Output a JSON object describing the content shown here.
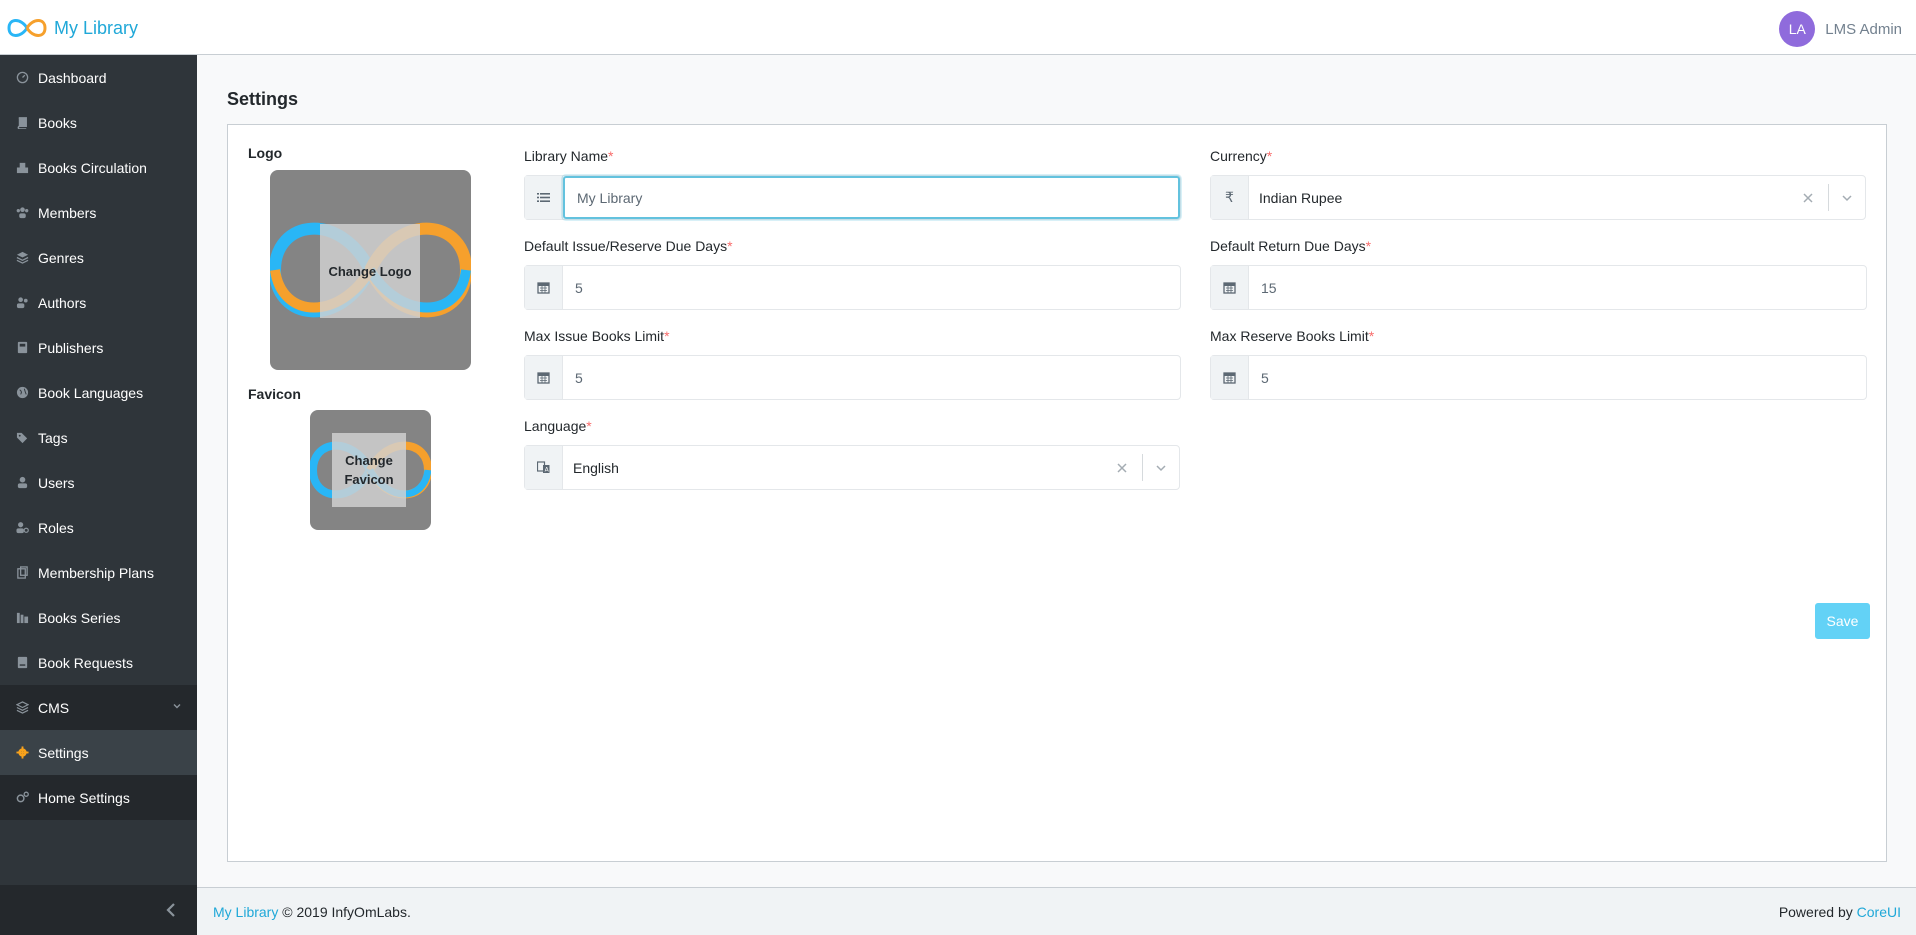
{
  "header": {
    "brand": "My Library",
    "user_initials": "LA",
    "user_name": "LMS Admin"
  },
  "sidebar": {
    "items": [
      {
        "label": "Dashboard",
        "icon": "speedometer-icon"
      },
      {
        "label": "Books",
        "icon": "book-icon"
      },
      {
        "label": "Books Circulation",
        "icon": "circulation-icon"
      },
      {
        "label": "Members",
        "icon": "members-icon"
      },
      {
        "label": "Genres",
        "icon": "layers-icon"
      },
      {
        "label": "Authors",
        "icon": "authors-icon"
      },
      {
        "label": "Publishers",
        "icon": "publisher-icon"
      },
      {
        "label": "Book Languages",
        "icon": "globe-icon"
      },
      {
        "label": "Tags",
        "icon": "tags-icon"
      },
      {
        "label": "Users",
        "icon": "user-icon"
      },
      {
        "label": "Roles",
        "icon": "user-cog-icon"
      },
      {
        "label": "Membership Plans",
        "icon": "plans-icon"
      },
      {
        "label": "Books Series",
        "icon": "series-icon"
      },
      {
        "label": "Book Requests",
        "icon": "request-icon"
      },
      {
        "label": "CMS",
        "icon": "layers-icon"
      },
      {
        "label": "Settings",
        "icon": "gear-icon"
      },
      {
        "label": "Home Settings",
        "icon": "cogs-icon"
      }
    ],
    "active_item": "Settings",
    "active_color": "#f8a21c"
  },
  "page": {
    "title": "Settings"
  },
  "settings": {
    "logo_label": "Logo",
    "logo_button": "Change Logo",
    "favicon_label": "Favicon",
    "favicon_button": "Change Favicon",
    "library_name": {
      "label": "Library Name",
      "value": "My Library",
      "icon": "list-icon"
    },
    "currency": {
      "label": "Currency",
      "value": "Indian Rupee",
      "icon": "rupee-icon"
    },
    "issue_due_days": {
      "label": "Default Issue/Reserve Due Days",
      "value": "5",
      "icon": "calendar-icon"
    },
    "return_due_days": {
      "label": "Default Return Due Days",
      "value": "15",
      "icon": "calendar-icon"
    },
    "max_issue": {
      "label": "Max Issue Books Limit",
      "value": "5",
      "icon": "calendar-icon"
    },
    "max_reserve": {
      "label": "Max Reserve Books Limit",
      "value": "5",
      "icon": "calendar-icon"
    },
    "language": {
      "label": "Language",
      "value": "English",
      "icon": "translate-icon"
    },
    "required_mark": "*",
    "save_label": "Save"
  },
  "footer": {
    "brand_link": "My Library",
    "copyright": "© 2019 InfyOmLabs.",
    "powered_by": "Powered by",
    "powered_link": "CoreUI"
  },
  "colors": {
    "accent": "#20a8d8",
    "sidebar_bg": "#2f353a",
    "save_button": "#63d2f6",
    "focus_border": "#63c2de",
    "required": "#f86c6b",
    "avatar": "#8f6bdc"
  }
}
